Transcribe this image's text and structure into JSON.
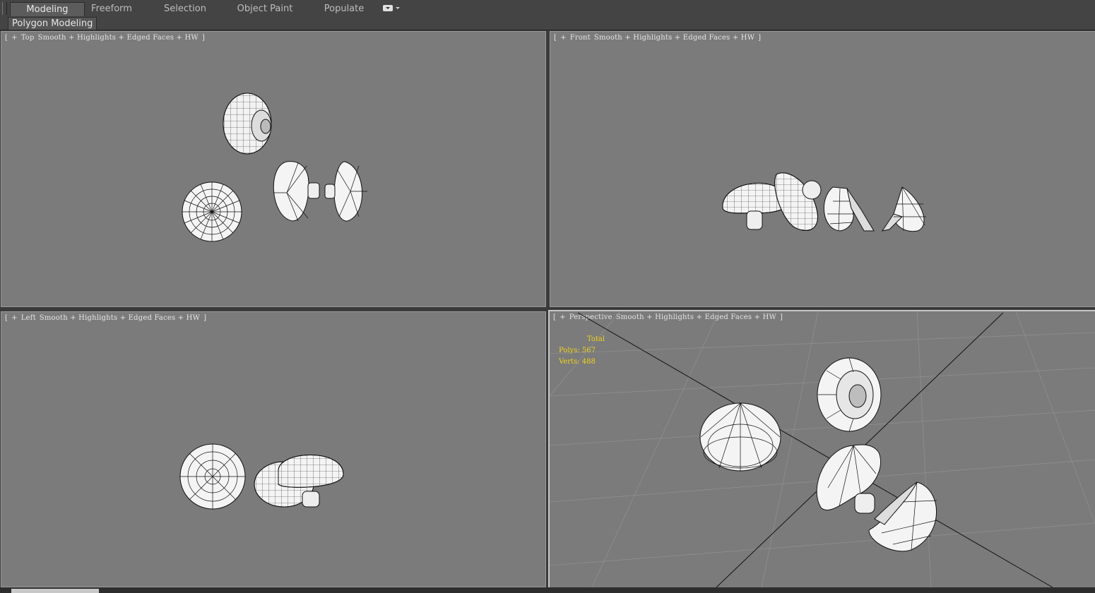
{
  "ribbon": {
    "tabs": [
      {
        "label": "Modeling",
        "active": true
      },
      {
        "label": "Freeform"
      },
      {
        "label": "Selection"
      },
      {
        "label": "Object Paint"
      },
      {
        "label": "Populate"
      }
    ],
    "dropdown_icon": "show-panel-dropdown-icon"
  },
  "panel": {
    "label": "Polygon Modeling"
  },
  "viewports": {
    "top": {
      "bracket_open": "[",
      "plus": "+",
      "view": "Top",
      "shading": "Smooth + Highlights + Edged Faces + HW",
      "bracket_close": "]"
    },
    "front": {
      "bracket_open": "[",
      "plus": "+",
      "view": "Front",
      "shading": "Smooth + Highlights + Edged Faces + HW",
      "bracket_close": "]"
    },
    "left": {
      "bracket_open": "[",
      "plus": "+",
      "view": "Left",
      "shading": "Smooth + Highlights + Edged Faces + HW",
      "bracket_close": "]"
    },
    "perspective": {
      "bracket_open": "[",
      "plus": "+",
      "view": "Perspective",
      "shading": "Smooth + Highlights + Edged Faces + HW",
      "bracket_close": "]"
    }
  },
  "stats": {
    "header": "Total",
    "polys_label": "Polys:",
    "polys": "567",
    "verts_label": "Verts:",
    "verts": "488"
  },
  "colors": {
    "viewport_bg": "#7b7b7b",
    "stats_text": "#f2d21b",
    "mesh_fill": "#f4f4f4",
    "mesh_edge": "#111111"
  }
}
